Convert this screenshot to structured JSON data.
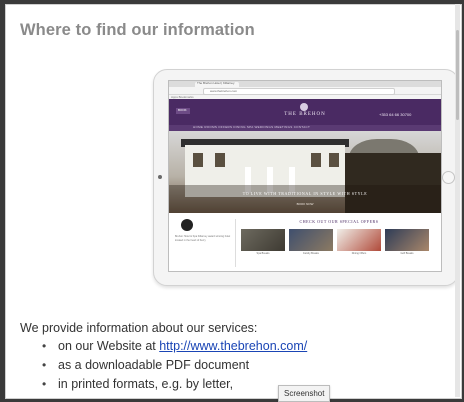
{
  "slide": {
    "title": "Where to find our information",
    "intro": "We provide information about our services:",
    "bullets": [
      {
        "prefix": "on our Website at ",
        "link": "http://www.thebrehon.com/"
      },
      {
        "text": "as a downloadable PDF document"
      },
      {
        "text": "in printed formats, e.g. by letter,"
      }
    ]
  },
  "tooltip": {
    "text": "Screenshot"
  },
  "tablet": {
    "browser_tab": "The Brehon Hotel | Killarney",
    "address": "www.thebrehon.com",
    "bookmarks": "Apps   Bookmarks",
    "site": {
      "book_button": "BOOK",
      "logo": "THE BREHON",
      "phone": "+353 64 66 30700",
      "nav": "HOME   ROOMS   OFFERS   DINING   SPA   WEDDINGS   MEETINGS   CONTACT",
      "hero_caption": "TO LIVE WITH TRADITIONAL IN STYLE WITH STYLE",
      "hero_sub": "BOOK NOW",
      "award_text": "Brehon Hotel & Spa Killarney award winning hotel located in the heart of Kerry",
      "offers_title": "CHECK OUT OUR SPECIAL OFFERS",
      "offers": [
        "Spa Breaks",
        "Family Breaks",
        "Dining Offers",
        "Golf Breaks"
      ]
    }
  },
  "colors": {
    "title_gray": "#8a8a8a",
    "link_blue": "#1a45b5",
    "brand_purple": "#4a2a63"
  }
}
